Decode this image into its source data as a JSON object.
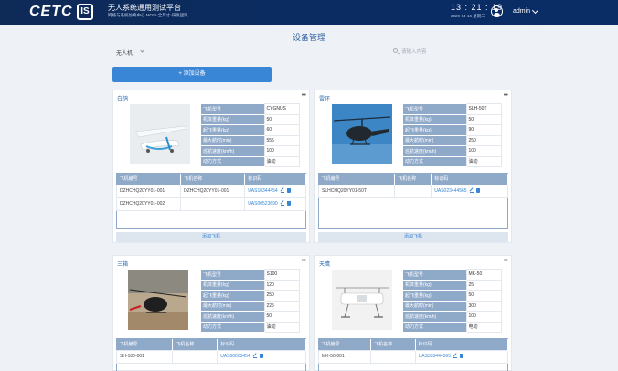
{
  "header": {
    "logo": "CETC",
    "logo2": "IS",
    "system_name": "无人系统通用测试平台",
    "system_sub": "网络与系统仿真中心 MOSI·全尺寸·研发团队",
    "clock": "13 : 21 : 19",
    "date": "2020-04-16 星期三",
    "username": "admin"
  },
  "page": {
    "title": "设备管理",
    "type_select": "无人机",
    "search_placeholder": "请输入内容",
    "add_button": "+ 添加设备"
  },
  "spec_labels": [
    "飞机型号",
    "机体重量(kg)",
    "起飞重量(kg)",
    "最大航时(min)",
    "巡航速度(km/h)",
    "动力方式"
  ],
  "table_headers": [
    "飞机编号",
    "飞机名称",
    "标识码"
  ],
  "add_craft_label": "添加飞机",
  "cards": [
    {
      "title": "白鸽",
      "specs": [
        "CYGNUS",
        "50",
        "60",
        "555",
        "100",
        "油动"
      ],
      "rows": [
        {
          "id": "DZHCHQ20YY01-001",
          "name": "DZHCHQ20YY01-001",
          "code": "UAS10344454"
        },
        {
          "id": "DZHCHQ20YY01-002",
          "name": "",
          "code": "UAS00523690"
        }
      ]
    },
    {
      "title": "雷环",
      "specs": [
        "SLH-50T",
        "50",
        "90",
        "250",
        "100",
        "油动"
      ],
      "rows": [
        {
          "id": "SLHCHQ20YY01-50T",
          "name": "",
          "code": "UAS023444565"
        }
      ]
    },
    {
      "title": "三箱",
      "specs": [
        "S100",
        "120",
        "250",
        "225",
        "50",
        "油动"
      ],
      "rows": [
        {
          "id": "SH-100-001",
          "name": "",
          "code": "UAS00003454"
        }
      ]
    },
    {
      "title": "天鹰",
      "specs": [
        "MK-50",
        "25",
        "50",
        "300",
        "100",
        "电动"
      ],
      "rows": [
        {
          "id": "MK-50-001",
          "name": "",
          "code": "UAS333444565"
        }
      ]
    }
  ]
}
